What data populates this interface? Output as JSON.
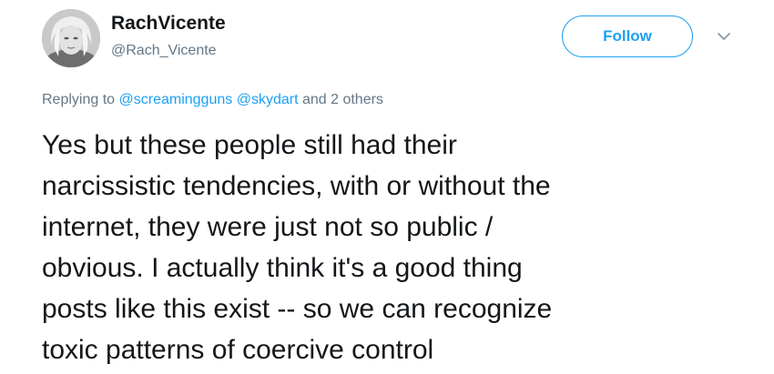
{
  "author": {
    "display_name": "RachVicente",
    "handle": "@Rach_Vicente"
  },
  "actions": {
    "follow_label": "Follow",
    "more_icon": "chevron-down-icon"
  },
  "reply": {
    "prefix": "Replying to",
    "mention_1": "@screamingguns",
    "mention_2": "@skydart",
    "suffix": "and 2 others"
  },
  "tweet": {
    "lines": [
      "Yes but these people still had their",
      "narcissistic tendencies, with or without the",
      "internet, they were just not so public /",
      "obvious. I actually think it's a good thing",
      "posts like this exist -- so we can recognize",
      "toxic patterns of coercive control"
    ]
  },
  "colors": {
    "accent": "#1da1f2",
    "secondary_text": "#657786",
    "primary_text": "#14171a"
  }
}
